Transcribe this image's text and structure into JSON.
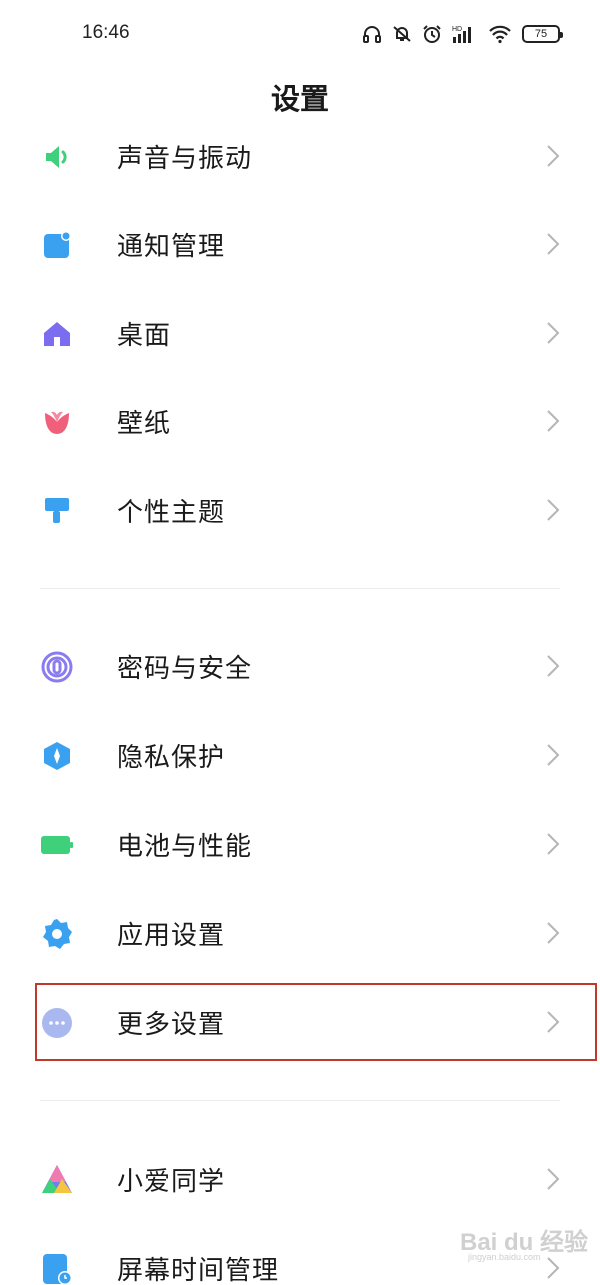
{
  "status_bar": {
    "time": "16:46",
    "battery": "75",
    "icons": [
      "headphones-icon",
      "bell-muted-icon",
      "alarm-icon",
      "hd-signal-icon",
      "wifi-icon",
      "battery-icon"
    ]
  },
  "page": {
    "title": "设置"
  },
  "group1": [
    {
      "label": "声音与振动",
      "icon": "speaker-icon",
      "color": "#3ed07a"
    },
    {
      "label": "通知管理",
      "icon": "notification-icon",
      "color": "#3aa0f0"
    },
    {
      "label": "桌面",
      "icon": "home-icon",
      "color": "#7b6cf0"
    },
    {
      "label": "壁纸",
      "icon": "tulip-icon",
      "color": "#f0607a"
    },
    {
      "label": "个性主题",
      "icon": "brush-icon",
      "color": "#3aa0f0"
    }
  ],
  "group2": [
    {
      "label": "密码与安全",
      "icon": "fingerprint-icon",
      "color": "#8a7cf0"
    },
    {
      "label": "隐私保护",
      "icon": "privacy-shield-icon",
      "color": "#3aa0f0"
    },
    {
      "label": "电池与性能",
      "icon": "battery-performance-icon",
      "color": "#3ed07a"
    },
    {
      "label": "应用设置",
      "icon": "gear-icon",
      "color": "#3aa0f0"
    },
    {
      "label": "更多设置",
      "icon": "more-dots-icon",
      "color": "#a9b8ef",
      "highlighted": true
    }
  ],
  "group3": [
    {
      "label": "小爱同学",
      "icon": "xiaoai-icon",
      "color": "#6e7df5"
    },
    {
      "label": "屏幕时间管理",
      "icon": "screen-time-icon",
      "color": "#3aa0f0"
    }
  ],
  "watermark": {
    "brand": "Bai du 经验",
    "url": "jingyan.baidu.com"
  }
}
